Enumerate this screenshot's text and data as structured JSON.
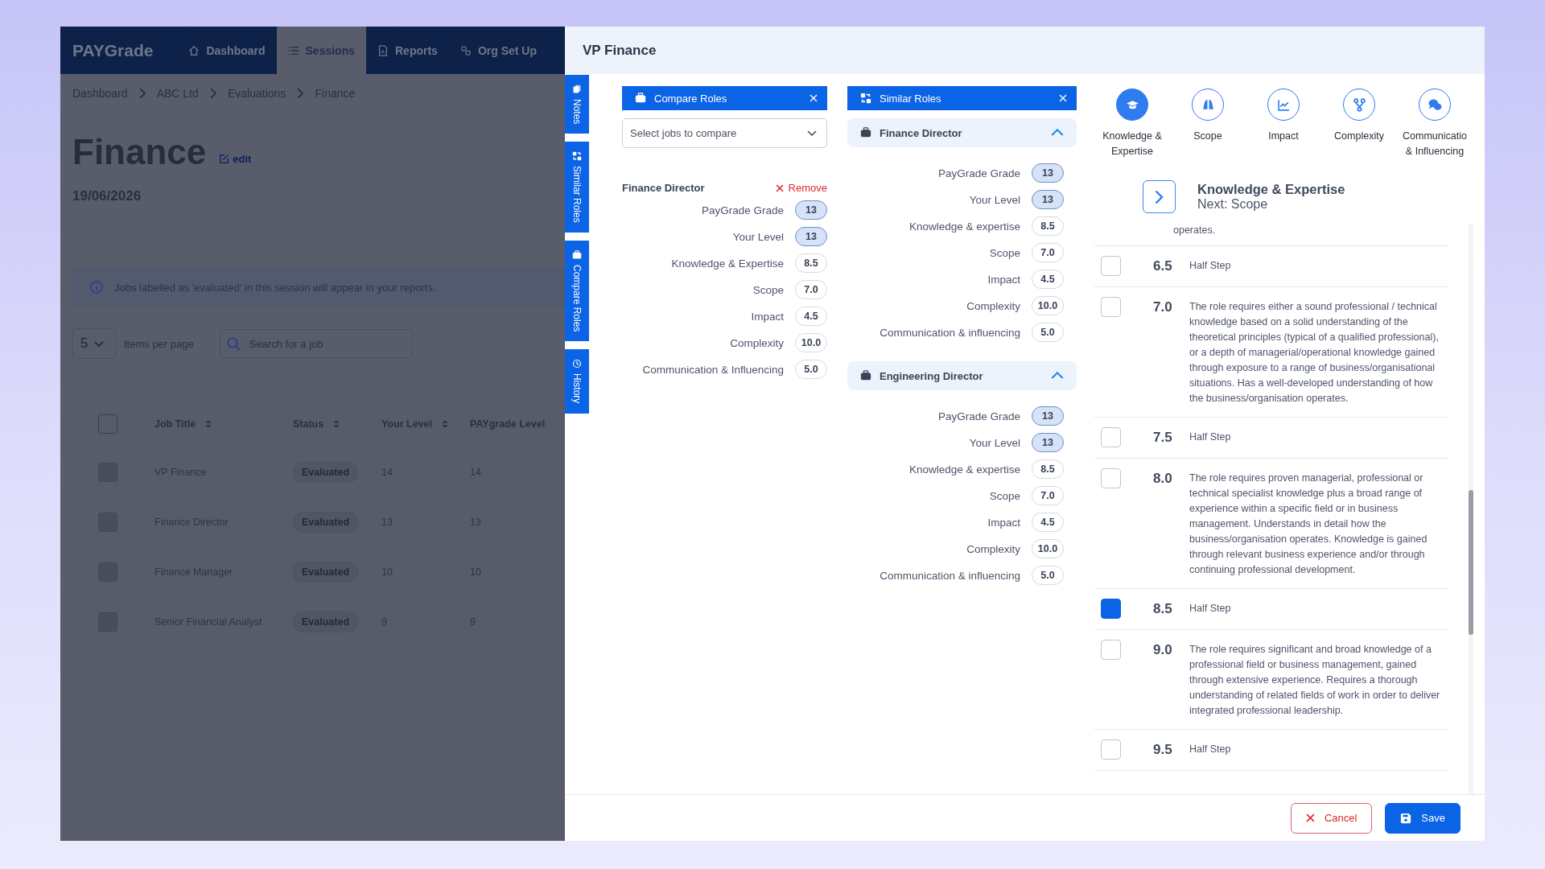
{
  "app": {
    "brand": "PAYGrade",
    "nav": [
      {
        "label": "Dashboard",
        "selected": false
      },
      {
        "label": "Sessions",
        "selected": true
      },
      {
        "label": "Reports",
        "selected": false
      },
      {
        "label": "Org Set Up",
        "selected": false
      }
    ],
    "breadcrumbs": [
      "Dashboard",
      "ABC Ltd",
      "Evaluations",
      "Finance"
    ],
    "title": "Finance",
    "edit_link": "edit",
    "date": "19/06/2026",
    "info": "Jobs labelled as 'evaluated' in this session will appear in your reports.",
    "page_size": "5",
    "page_size_label": "Items per page",
    "search": {
      "placeholder": "Search for a job"
    },
    "table": {
      "select_all_checked": false,
      "columns": [
        {
          "label": "Job Title",
          "sortable": true
        },
        {
          "label": "Status",
          "sortable": true
        },
        {
          "label": "Your Level",
          "sortable": true
        },
        {
          "label": "PAYgrade Level",
          "sortable": false
        }
      ],
      "rows": [
        {
          "title": "VP Finance",
          "status": "Evaluated",
          "your_level": "14",
          "paygrade_level": "14",
          "checked": false
        },
        {
          "title": "Finance Director",
          "status": "Evaluated",
          "your_level": "13",
          "paygrade_level": "13",
          "checked": false
        },
        {
          "title": "Finance Manager",
          "status": "Evaluated",
          "your_level": "10",
          "paygrade_level": "10",
          "checked": false
        },
        {
          "title": "Senior Financial Analyst",
          "status": "Evaluated",
          "your_level": "9",
          "paygrade_level": "9",
          "checked": false
        }
      ]
    }
  },
  "drawer": {
    "title": "VP Finance",
    "side_tabs": [
      {
        "label": "Notes"
      },
      {
        "label": "Similar Roles"
      },
      {
        "label": "Compare Roles"
      },
      {
        "label": "History"
      }
    ],
    "compare": {
      "title": "Compare Roles",
      "select_placeholder": "Select jobs to compare",
      "role": {
        "name": "Finance Director",
        "remove": "Remove",
        "metrics": [
          {
            "label": "PayGrade Grade",
            "value": "13",
            "highlighted": true
          },
          {
            "label": "Your Level",
            "value": "13",
            "highlighted": true
          },
          {
            "label": "Knowledge & Expertise",
            "value": "8.5",
            "highlighted": false
          },
          {
            "label": "Scope",
            "value": "7.0",
            "highlighted": false
          },
          {
            "label": "Impact",
            "value": "4.5",
            "highlighted": false
          },
          {
            "label": "Complexity",
            "value": "10.0",
            "highlighted": false
          },
          {
            "label": "Communication & Influencing",
            "value": "5.0",
            "highlighted": false
          }
        ]
      }
    },
    "similar": {
      "title": "Similar Roles",
      "roles": [
        {
          "name": "Finance Director",
          "expanded": true,
          "metrics": [
            {
              "label": "PayGrade Grade",
              "value": "13",
              "highlighted": true
            },
            {
              "label": "Your Level",
              "value": "13",
              "highlighted": true
            },
            {
              "label": "Knowledge & expertise",
              "value": "8.5",
              "highlighted": false
            },
            {
              "label": "Scope",
              "value": "7.0",
              "highlighted": false
            },
            {
              "label": "Impact",
              "value": "4.5",
              "highlighted": false
            },
            {
              "label": "Complexity",
              "value": "10.0",
              "highlighted": false
            },
            {
              "label": "Communication & influencing",
              "value": "5.0",
              "highlighted": false
            }
          ]
        },
        {
          "name": "Engineering Director",
          "expanded": true,
          "metrics": [
            {
              "label": "PayGrade Grade",
              "value": "13",
              "highlighted": true
            },
            {
              "label": "Your Level",
              "value": "13",
              "highlighted": true
            },
            {
              "label": "Knowledge & expertise",
              "value": "8.5",
              "highlighted": false
            },
            {
              "label": "Scope",
              "value": "7.0",
              "highlighted": false
            },
            {
              "label": "Impact",
              "value": "4.5",
              "highlighted": false
            },
            {
              "label": "Complexity",
              "value": "10.0",
              "highlighted": false
            },
            {
              "label": "Communication & influencing",
              "value": "5.0",
              "highlighted": false
            }
          ]
        }
      ]
    },
    "factors": [
      {
        "label": "Knowledge & Expertise",
        "selected": true
      },
      {
        "label": "Scope",
        "selected": false
      },
      {
        "label": "Impact",
        "selected": false
      },
      {
        "label": "Complexity",
        "selected": false
      },
      {
        "label": "Communicatio & Influencing",
        "selected": false
      }
    ],
    "current": {
      "title": "Knowledge & Expertise",
      "next": "Next: Scope"
    },
    "levels": [
      {
        "kind": "tail",
        "text": "operates."
      },
      {
        "kind": "level",
        "value": "6.5",
        "text": "Half Step",
        "checked": false
      },
      {
        "kind": "level",
        "value": "7.0",
        "text": "The role requires either a sound professional / technical knowledge based on a solid understanding of the theoretical principles (typical of a qualified professional), or a depth of managerial/operational knowledge gained through exposure to a range of business/organisational situations. Has a well-developed understanding of how the business/organisation operates.",
        "checked": false
      },
      {
        "kind": "level",
        "value": "7.5",
        "text": "Half Step",
        "checked": false
      },
      {
        "kind": "level",
        "value": "8.0",
        "text": "The role requires proven managerial, professional or technical specialist knowledge plus a broad range of experience within a specific field or in business management. Understands in detail how the business/organisation operates. Knowledge is gained through relevant business experience and/or through continuing professional development.",
        "checked": false
      },
      {
        "kind": "level",
        "value": "8.5",
        "text": "Half Step",
        "checked": true
      },
      {
        "kind": "level",
        "value": "9.0",
        "text": "The role requires significant and broad knowledge of a professional field or business management, gained through extensive experience. Requires a thorough understanding of related fields of work in order to deliver integrated professional leadership.",
        "checked": false
      },
      {
        "kind": "level",
        "value": "9.5",
        "text": "Half Step",
        "checked": false
      }
    ],
    "buttons": [
      {
        "kind": "cancel",
        "label": "Cancel"
      },
      {
        "kind": "save",
        "label": "Save"
      }
    ]
  }
}
